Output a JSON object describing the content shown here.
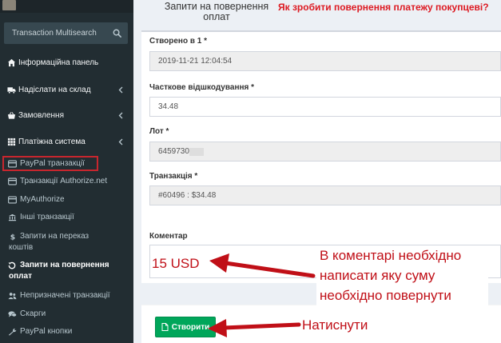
{
  "sidebar": {
    "search": {
      "placeholder": "Transaction Multisearch"
    },
    "menu": [
      {
        "label": "Інформаційна панель",
        "icon": "dashboard-icon",
        "expandable": false
      },
      {
        "label": "Надіслати на склад",
        "icon": "truck-icon",
        "expandable": true
      },
      {
        "label": "Замовлення",
        "icon": "basket-icon",
        "expandable": true
      },
      {
        "label": "Платіжна система",
        "icon": "grid-icon",
        "expandable": true
      }
    ],
    "submenu": [
      {
        "label": "PayPal транзакції",
        "icon": "credit-card-icon",
        "active": false,
        "highlighted": true
      },
      {
        "label": "Транзакції Authorize.net",
        "icon": "credit-card-icon",
        "active": false
      },
      {
        "label": "MyAuthorize",
        "icon": "credit-card-icon",
        "active": false
      },
      {
        "label": "Інші транзакції",
        "icon": "bank-icon",
        "active": false
      },
      {
        "label_line1": "Запити на переказ",
        "label_line2": "коштів",
        "icon": "dollar-icon",
        "active": false
      },
      {
        "label_line1": "Запити на повернення",
        "label_line2": "оплат",
        "icon": "refund-icon",
        "active": true
      },
      {
        "label": "Непризначені транзакції",
        "icon": "users-icon",
        "active": false
      },
      {
        "label": "Скарги",
        "icon": "comments-icon",
        "active": false
      },
      {
        "label": "PayPal кнопки",
        "icon": "wrench-icon",
        "active": false
      }
    ]
  },
  "header": {
    "title_line1": "Запити на повернення",
    "title_line2": "оплат",
    "help_link": "Як зробити повернення платежу покупцеві?"
  },
  "form": {
    "created": {
      "label": "Створено в 1 *",
      "value": "2019-11-21 12:04:54"
    },
    "partial": {
      "label": "Часткове відшкодування *",
      "value": "34.48"
    },
    "lot": {
      "label": "Лот *",
      "value": "6459730"
    },
    "transaction": {
      "label": "Транзакція *",
      "value": "#60496 : $34.48"
    },
    "comment": {
      "label": "Коментар",
      "value": ""
    }
  },
  "footer": {
    "create_label": "Створити"
  },
  "annotations": {
    "usd": "15 USD",
    "comment_line1": "В коментарі необхідно",
    "comment_line2": "написати яку суму",
    "comment_line3": "необхідно повернути",
    "click": "Натиснути"
  },
  "colors": {
    "sidebar_bg": "#222d32",
    "accent_red": "#c00f17",
    "button_green": "#00a65a",
    "link_red": "#dd1a22"
  }
}
